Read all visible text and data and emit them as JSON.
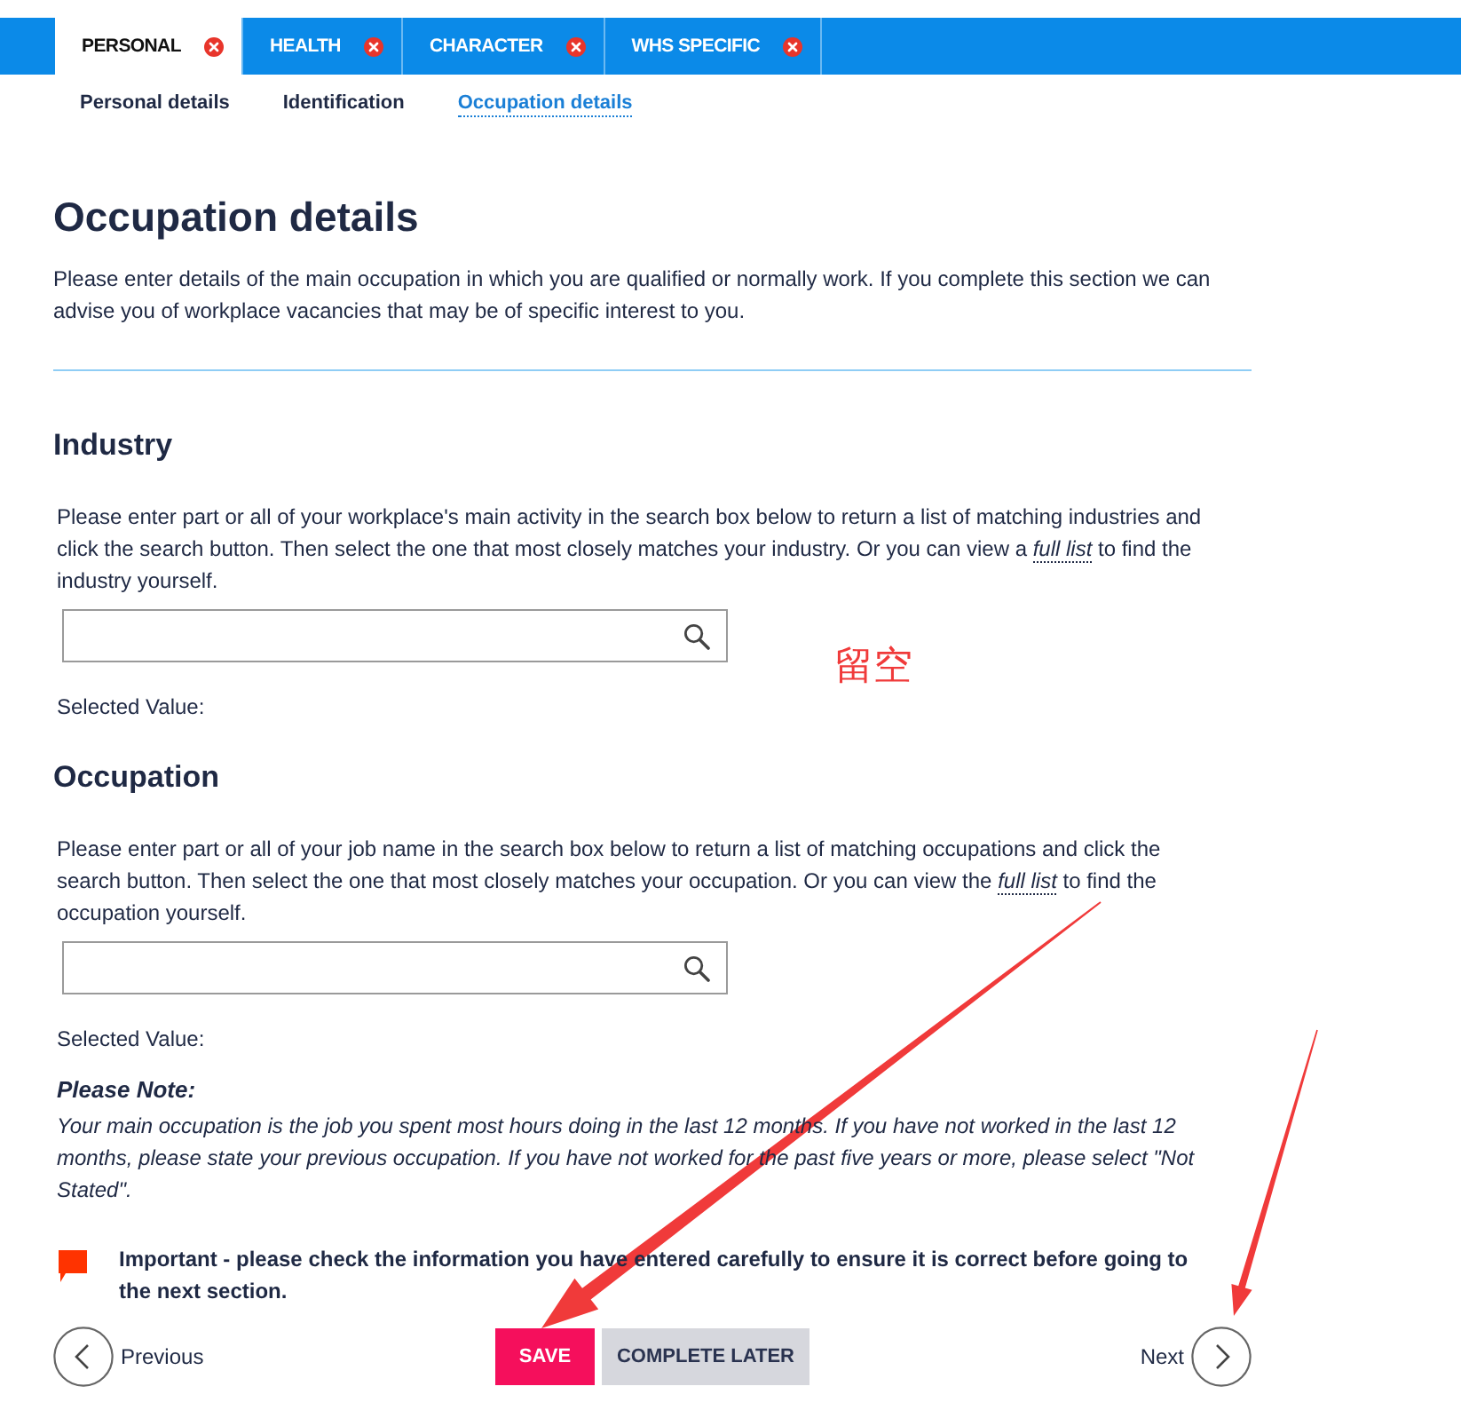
{
  "tabs": [
    {
      "label": "PERSONAL",
      "selected": true
    },
    {
      "label": "HEALTH",
      "selected": false
    },
    {
      "label": "CHARACTER",
      "selected": false
    },
    {
      "label": "WHS SPECIFIC",
      "selected": false
    }
  ],
  "subnav": [
    {
      "label": "Personal details",
      "selected": false
    },
    {
      "label": "Identification",
      "selected": false
    },
    {
      "label": "Occupation details",
      "selected": true
    }
  ],
  "header": {
    "title": "Occupation details",
    "intro": "Please enter details of the main occupation in which you are qualified or normally work. If you complete this section we can advise you of workplace vacancies that may be of specific interest to you."
  },
  "sections": [
    {
      "heading": "Industry",
      "text_before_link": "Please enter part or all of your workplace's main activity in the search box below to return a list of matching industries and click the search button. Then select the one that most closely matches your industry. Or you can view a ",
      "link": "full list",
      "text_after_link": " to find the industry yourself.",
      "selected_value_label": "Selected Value:"
    },
    {
      "heading": "Occupation",
      "text_before_link": "Please enter part or all of your job name in the search box below to return a list of matching occupations and click the search button. Then select the one that most closely matches your occupation. Or you can view the ",
      "link": "full list",
      "text_after_link": " to find the occupation yourself.",
      "selected_value_label": "Selected Value:"
    }
  ],
  "note": {
    "title": "Please Note:",
    "text": "Your main occupation is the job you spent most hours doing in the last 12 months. If you have not worked in the last 12 months, please state your previous occupation. If you have not worked for the past five years or more, please select \"Not Stated\"."
  },
  "important": {
    "text": "Important - please check the information you have entered carefully to ensure it is correct before going to the next section."
  },
  "nav": {
    "previous": "Previous",
    "save": "SAVE",
    "complete_later": "COMPLETE LATER",
    "next": "Next"
  },
  "annotation": {
    "text": "留空"
  }
}
